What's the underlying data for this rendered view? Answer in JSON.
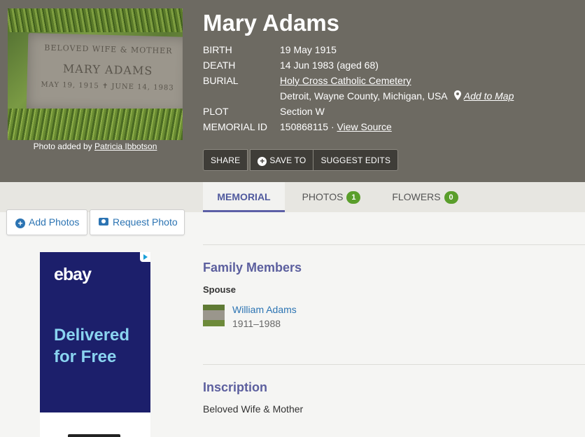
{
  "photo": {
    "stone_line1": "BELOVED WIFE & MOTHER",
    "stone_line2": "MARY ADAMS",
    "stone_line3": "MAY 19, 1915 ✝ JUNE 14, 1983",
    "credit_prefix": "Photo added by",
    "credit_name": "Patricia Ibbotson"
  },
  "memorial": {
    "name": "Mary Adams",
    "facts": {
      "birth_label": "BIRTH",
      "birth_value": "19 May 1915",
      "death_label": "DEATH",
      "death_value": "14 Jun 1983 (aged 68)",
      "burial_label": "BURIAL",
      "burial_cemetery": "Holy Cross Catholic Cemetery",
      "burial_location": "Detroit, Wayne County, Michigan, USA",
      "add_to_map": "Add to Map",
      "plot_label": "PLOT",
      "plot_value": "Section W",
      "memorial_id_label": "MEMORIAL ID",
      "memorial_id_value": "150868115",
      "id_separator": "·",
      "view_source": "View Source"
    }
  },
  "actions": {
    "share": "SHARE",
    "save_to": "SAVE TO",
    "suggest_edits": "SUGGEST EDITS"
  },
  "tabs": [
    {
      "label": "MEMORIAL"
    },
    {
      "label": "PHOTOS",
      "count": "1"
    },
    {
      "label": "FLOWERS",
      "count": "0"
    }
  ],
  "side_buttons": {
    "add_photos": "Add Photos",
    "request_photo": "Request Photo"
  },
  "ad": {
    "logo": "ebay",
    "text": "Delivered for Free"
  },
  "family": {
    "title": "Family Members",
    "group_label": "Spouse",
    "members": [
      {
        "name": "William Adams",
        "years": "1911–1988"
      }
    ]
  },
  "inscription": {
    "title": "Inscription",
    "text": "Beloved Wife & Mother"
  },
  "colors": {
    "hero_bg": "#6d6a62",
    "accent_purple": "#5c5f9e",
    "link_blue": "#2c74b3",
    "badge_green": "#5a9e2b",
    "ad_navy": "#1c1f6b"
  },
  "icons": [
    "map-pin-icon",
    "plus-circle-icon",
    "camera-icon",
    "ad-choices-icon"
  ]
}
